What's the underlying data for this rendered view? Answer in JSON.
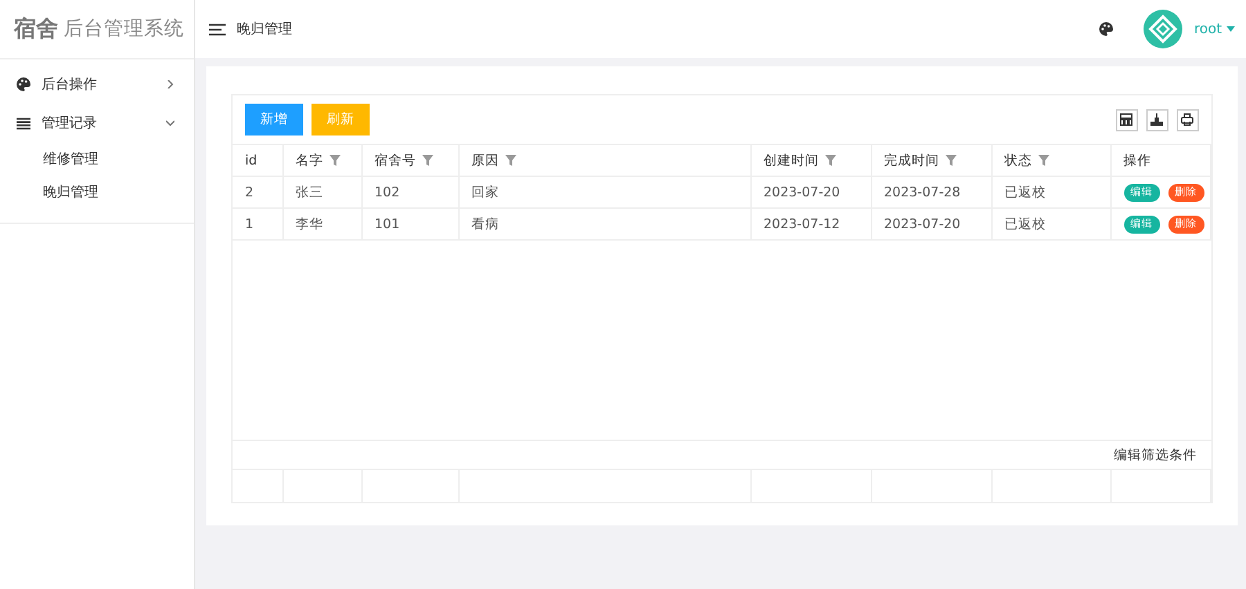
{
  "logo": {
    "strong": "宿舍",
    "rest": "后台管理系统"
  },
  "sidebar": {
    "items": [
      {
        "label": "后台操作",
        "kind": "palette",
        "expanded": false
      },
      {
        "label": "管理记录",
        "kind": "list",
        "expanded": true,
        "children": [
          {
            "label": "维修管理"
          },
          {
            "label": "晚归管理"
          }
        ]
      }
    ]
  },
  "header": {
    "title": "晚归管理",
    "user": "root"
  },
  "toolbar": {
    "buttons": [
      {
        "label": "新增",
        "kind": "primary"
      },
      {
        "label": "刷新",
        "kind": "warning"
      }
    ]
  },
  "table": {
    "columns": [
      {
        "label": "id",
        "filter": false
      },
      {
        "label": "名字",
        "filter": true
      },
      {
        "label": "宿舍号",
        "filter": true
      },
      {
        "label": "原因",
        "filter": true
      },
      {
        "label": "创建时间",
        "filter": true
      },
      {
        "label": "完成时间",
        "filter": true
      },
      {
        "label": "状态",
        "filter": true
      },
      {
        "label": "操作",
        "filter": false
      }
    ],
    "rows": [
      {
        "cells": [
          "2",
          "张三",
          "102",
          "回家",
          "2023-07-20",
          "2023-07-28",
          "已返校"
        ],
        "actions": [
          {
            "label": "编辑",
            "kind": "edit"
          },
          {
            "label": "删除",
            "kind": "delete"
          }
        ]
      },
      {
        "cells": [
          "1",
          "李华",
          "101",
          "看病",
          "2023-07-12",
          "2023-07-20",
          "已返校"
        ],
        "actions": [
          {
            "label": "编辑",
            "kind": "edit"
          },
          {
            "label": "删除",
            "kind": "delete"
          }
        ]
      }
    ],
    "footer_link": "编辑筛选条件"
  }
}
